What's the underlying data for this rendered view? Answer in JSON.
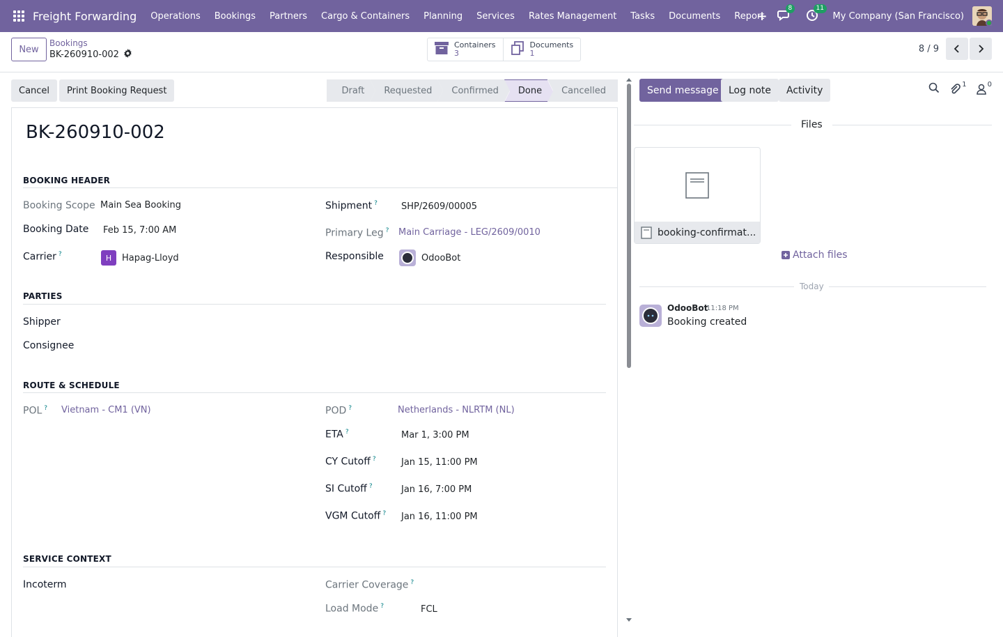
{
  "navbar": {
    "app_title": "Freight Forwarding",
    "menu": [
      "Operations",
      "Bookings",
      "Partners",
      "Cargo & Containers",
      "Planning",
      "Services",
      "Rates Management",
      "Tasks",
      "Documents",
      "Report"
    ],
    "messages_count": "8",
    "activities_count": "11",
    "company": "My Company (San Francisco)",
    "accent_color": "#71639e"
  },
  "control_panel": {
    "new_label": "New",
    "breadcrumb_parent": "Bookings",
    "breadcrumb_current": "BK-260910-002",
    "smart_buttons": [
      {
        "label": "Containers",
        "value": "3",
        "icon": "archive-icon"
      },
      {
        "label": "Documents",
        "value": "1",
        "icon": "files-icon"
      }
    ],
    "pager": "8 / 9"
  },
  "statusbar": {
    "buttons": [
      "Cancel",
      "Print Booking Request"
    ],
    "stages": [
      "Draft",
      "Requested",
      "Confirmed",
      "Done",
      "Cancelled"
    ],
    "active_stage": "Done"
  },
  "form": {
    "title": "BK-260910-002",
    "sections": {
      "booking_header": "BOOKING HEADER",
      "parties": "PARTIES",
      "route_schedule": "ROUTE & SCHEDULE",
      "service_context": "SERVICE CONTEXT"
    },
    "booking_header": {
      "booking_scope_label": "Booking Scope",
      "booking_scope": "Main Sea Booking",
      "booking_date_label": "Booking Date",
      "booking_date": "Feb 15, 7:00 AM",
      "carrier_label": "Carrier",
      "carrier_initial": "H",
      "carrier": "Hapag-Lloyd",
      "shipment_label": "Shipment",
      "shipment": "SHP/2609/00005",
      "primary_leg_label": "Primary Leg",
      "primary_leg": "Main Carriage - LEG/2609/0010",
      "responsible_label": "Responsible",
      "responsible": "OdooBot"
    },
    "parties": {
      "shipper_label": "Shipper",
      "consignee_label": "Consignee"
    },
    "route": {
      "pol_label": "POL",
      "pol": "Vietnam - CM1 (VN)",
      "pod_label": "POD",
      "pod": "Netherlands - NLRTM (NL)",
      "eta_label": "ETA",
      "eta": "Mar 1, 3:00 PM",
      "cy_cutoff_label": "CY Cutoff",
      "cy_cutoff": "Jan 15, 11:00 PM",
      "si_cutoff_label": "SI Cutoff",
      "si_cutoff": "Jan 16, 7:00 PM",
      "vgm_cutoff_label": "VGM Cutoff",
      "vgm_cutoff": "Jan 16, 11:00 PM"
    },
    "service": {
      "incoterm_label": "Incoterm",
      "carrier_coverage_label": "Carrier Coverage",
      "load_mode_label": "Load Mode",
      "load_mode": "FCL"
    },
    "help_marker": "?"
  },
  "chatter": {
    "send_message": "Send message",
    "log_note": "Log note",
    "activity": "Activity",
    "attachments_count": "1",
    "followers_count": "0",
    "files_label": "Files",
    "file_name": "booking-confirmat...",
    "attach_files": "Attach files",
    "today_label": "Today",
    "message": {
      "author": "OdooBot",
      "time": "11:18 PM",
      "body": "Booking created"
    }
  }
}
